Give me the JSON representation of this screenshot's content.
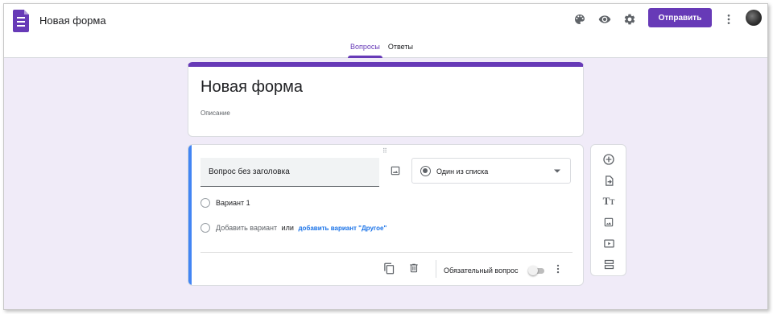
{
  "header": {
    "title": "Новая форма",
    "send_label": "Отправить",
    "icons": [
      "palette-icon",
      "eye-icon",
      "gear-icon",
      "more-vert-icon"
    ]
  },
  "tabs": [
    {
      "label": "Вопросы",
      "active": true
    },
    {
      "label": "Ответы",
      "active": false
    }
  ],
  "form": {
    "title": "Новая форма",
    "description_placeholder": "Описание"
  },
  "question": {
    "title": "Вопрос без заголовка",
    "type": "Один из списка",
    "options": [
      "Вариант 1"
    ],
    "add_option": "Добавить вариант",
    "or": "или",
    "add_other": "добавить вариант \"Другое\"",
    "required_label": "Обязательный вопрос",
    "required": false
  },
  "sidebar": {
    "icons": [
      "add-question-icon",
      "import-questions-icon",
      "add-title-icon",
      "add-image-icon",
      "add-video-icon",
      "add-section-icon"
    ]
  },
  "colors": {
    "accent": "#673ab7",
    "background": "#f0ebf8",
    "question_bar": "#4285f4",
    "link": "#1a73e8"
  }
}
